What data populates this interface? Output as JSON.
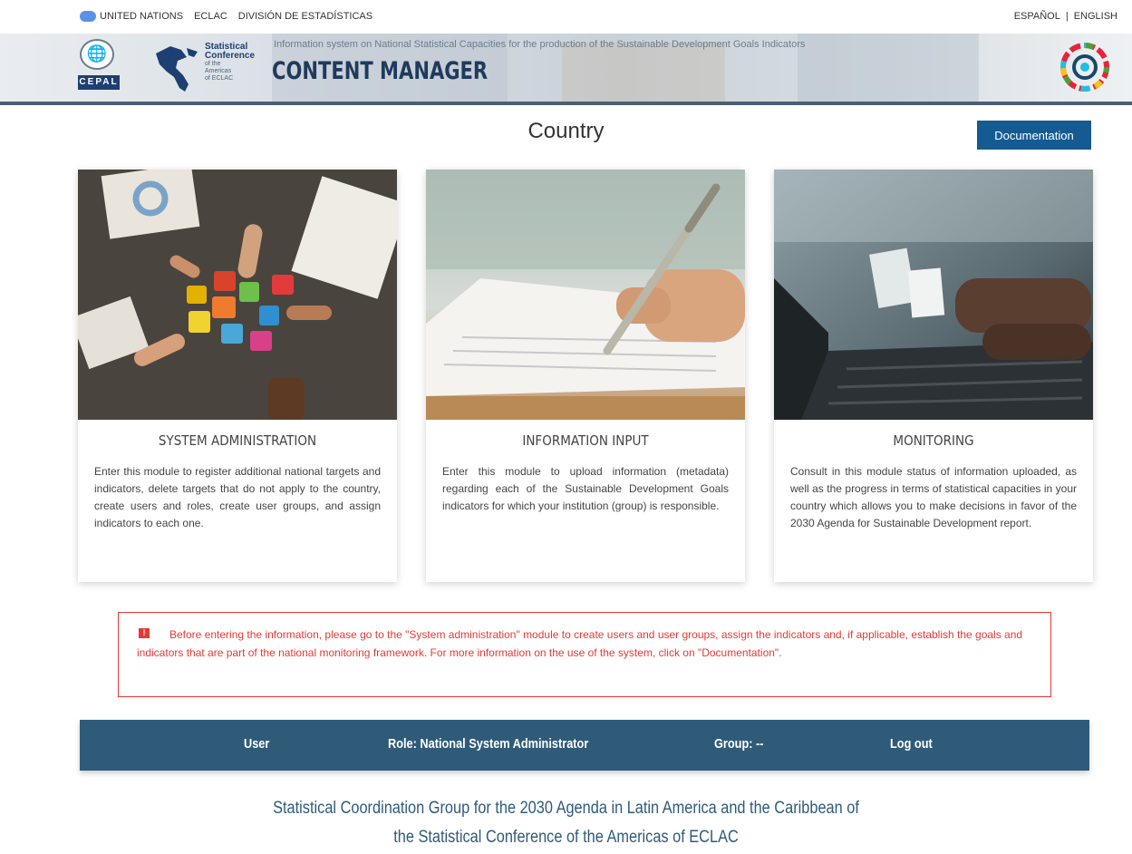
{
  "topbar": {
    "org_un": "UNITED NATIONS",
    "org_eclac": "ECLAC",
    "org_division": "DIVISIÓN DE ESTADÍSTICAS",
    "lang_es": "ESPAÑOL",
    "separator": "|",
    "lang_en": "ENGLISH"
  },
  "header": {
    "cepal_label": "CEPAL",
    "conference_line1": "Statistical",
    "conference_line2": "Conference",
    "conference_line3": "of the",
    "conference_line4": "Americas",
    "conference_line5": "of ECLAC",
    "subtitle": "Information system on National Statistical Capacities for the production of the Sustainable Development Goals Indicators",
    "title": "CONTENT MANAGER"
  },
  "page": {
    "title": "Country",
    "documentation_button": "Documentation"
  },
  "cards": [
    {
      "title": "SYSTEM ADMINISTRATION",
      "description": "Enter this module to register additional national targets and indicators, delete targets that do not apply to the country, create users and roles, create user groups, and assign indicators to each one."
    },
    {
      "title": "INFORMATION INPUT",
      "description": "Enter this module to upload information (metadata) regarding each of the Sustainable Development Goals indicators for which your institution (group) is responsible."
    },
    {
      "title": "MONITORING",
      "description": "Consult in this module status of information uploaded, as well as the progress in terms of statistical capacities in your country which allows you to make decisions in favor of the 2030 Agenda for Sustainable Development report."
    }
  ],
  "alert": {
    "icon_glyph": "!",
    "message": "Before entering the information, please go to the \"System administration\" module to create users and user groups, assign the indicators and, if applicable, establish the goals and indicators that are part of the national monitoring framework. For more information on the use of the system, click on \"Documentation\"."
  },
  "userbar": {
    "user": "User",
    "role": "Role: National System Administrator",
    "group": "Group: --",
    "logout": "Log out"
  },
  "footer": {
    "line1": "Statistical Coordination Group for the 2030 Agenda in Latin America and the Caribbean of",
    "line2": "the Statistical Conference of the Americas of ECLAC"
  }
}
